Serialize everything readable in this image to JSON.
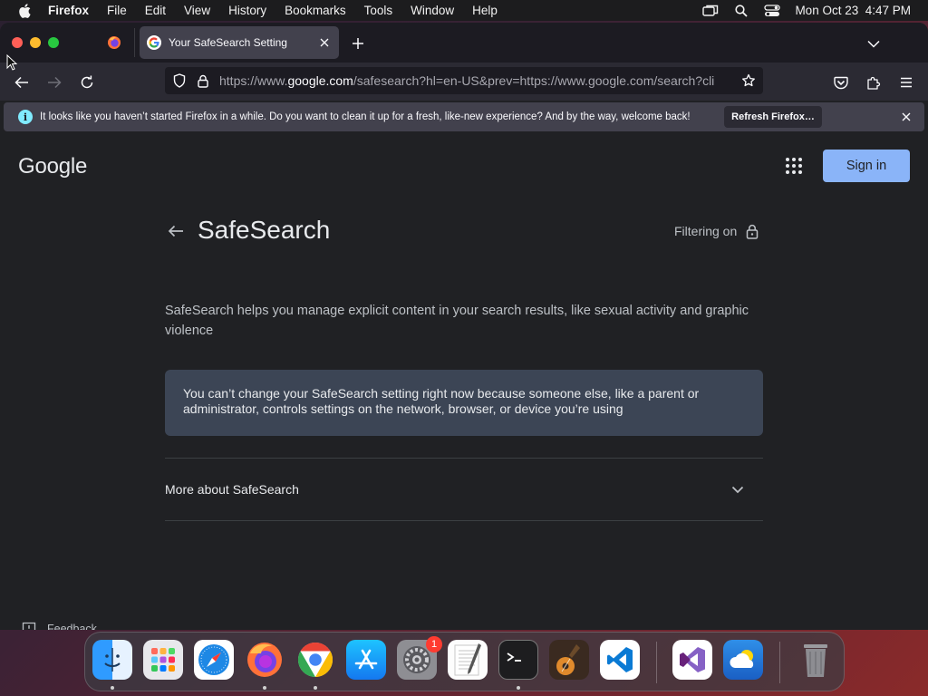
{
  "menubar": {
    "app_name": "Firefox",
    "items": [
      "File",
      "Edit",
      "View",
      "History",
      "Bookmarks",
      "Tools",
      "Window",
      "Help"
    ],
    "clock": "Mon Oct 23  4:47 PM"
  },
  "browser": {
    "active_tab_title": "Your SafeSearch Setting",
    "url_prefix": "https://www.",
    "url_host": "google.com",
    "url_rest": "/safesearch?hl=en-US&prev=https://www.google.com/search?cli",
    "notification": {
      "message": "It looks like you haven’t started Firefox in a while. Do you want to clean it up for a fresh, like-new experience? And by the way, welcome back!",
      "button_label": "Refresh Firefox…"
    }
  },
  "page": {
    "logo_text": "Google",
    "sign_in_label": "Sign in",
    "title": "SafeSearch",
    "filter_status": "Filtering on",
    "description": "SafeSearch helps you manage explicit content in your search results, like sexual activity and graphic violence",
    "notice": "You can’t change your SafeSearch setting right now because someone else, like a parent or administrator, controls settings on the network, browser, or device you’re using",
    "more_label": "More about SafeSearch",
    "feedback_label": "Feedback"
  },
  "dock": {
    "apps": [
      "Finder",
      "Launchpad",
      "Safari",
      "Firefox",
      "Google Chrome",
      "App Store",
      "System Settings",
      "TextEdit",
      "Terminal",
      "GarageBand",
      "Visual Studio Code",
      "Visual Studio",
      "Weather",
      "Trash"
    ],
    "system_settings_badge": "1"
  },
  "colors": {
    "page_background": "#202124",
    "sign_in_button": "#8ab4f8",
    "notice_background": "#3c4555",
    "firefox_toolbar": "#2b2a33"
  }
}
